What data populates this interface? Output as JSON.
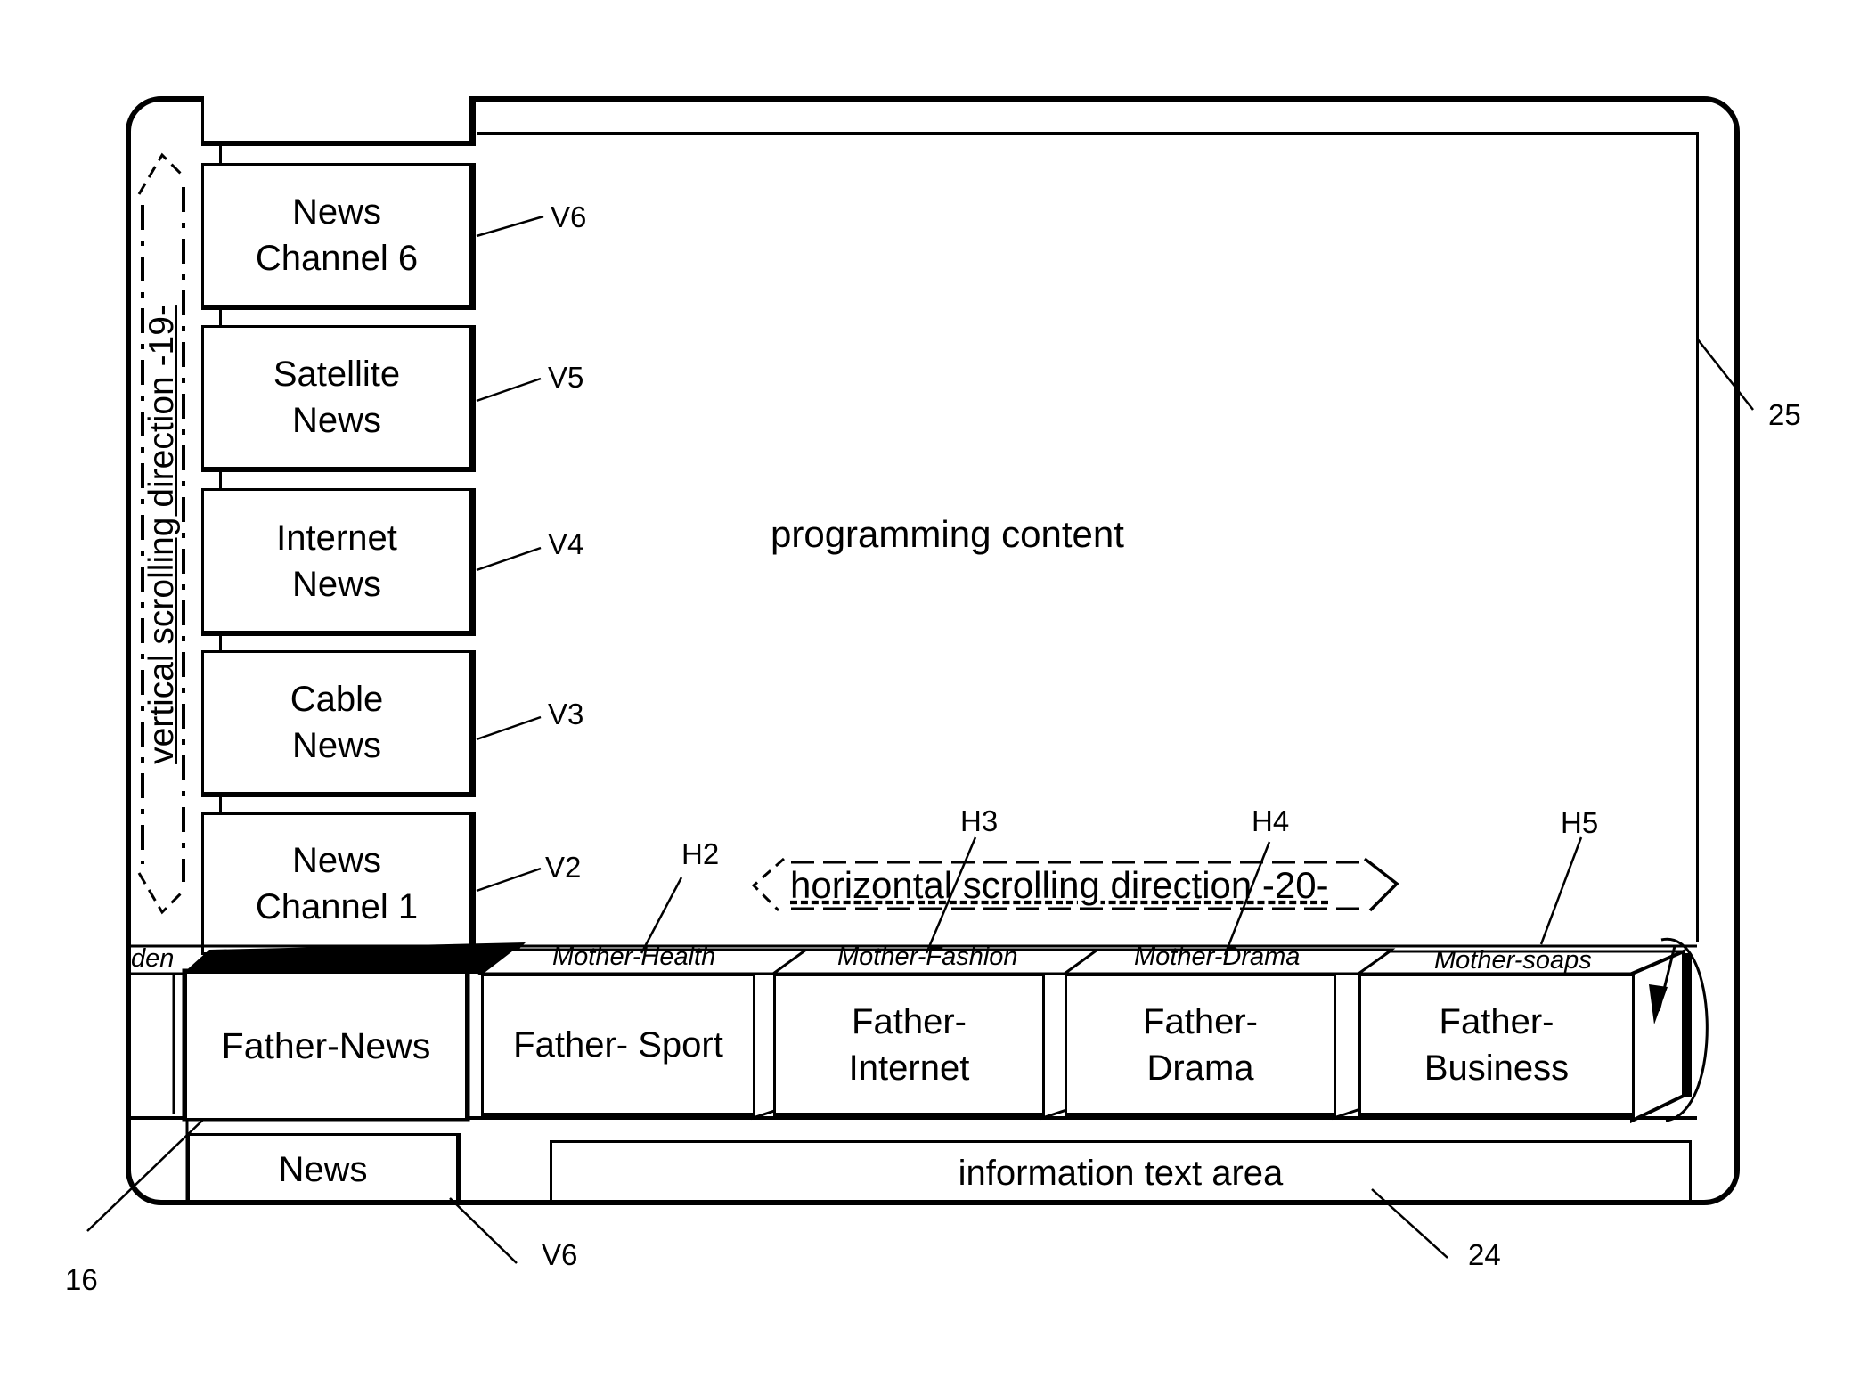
{
  "figure": {
    "programming_content": "programming content",
    "information_area": "information text area",
    "category_box": "News",
    "partial_left_label": "den"
  },
  "vertical_menu": {
    "direction_label": "vertical scrolling direction -19-",
    "items": [
      {
        "label_line1": "News",
        "label_line2": "Channel 6",
        "ref": "V6"
      },
      {
        "label_line1": "Satellite",
        "label_line2": "News",
        "ref": "V5"
      },
      {
        "label_line1": "Internet",
        "label_line2": "News",
        "ref": "V4"
      },
      {
        "label_line1": "Cable",
        "label_line2": "News",
        "ref": "V3"
      },
      {
        "label_line1": "News",
        "label_line2": "Channel 1",
        "ref": "V2"
      }
    ]
  },
  "horizontal_menu": {
    "direction_label": "horizontal scrolling direction -20-",
    "items": [
      {
        "label": "Father-News",
        "top_label": "",
        "ref": "",
        "selected": true
      },
      {
        "label": "Father- Sport",
        "top_label": "Mother-Health",
        "ref": "H2"
      },
      {
        "label_line1": "Father-",
        "label_line2": "Internet",
        "top_label": "Mother-Fashion",
        "ref": "H3"
      },
      {
        "label_line1": "Father-",
        "label_line2": "Drama",
        "top_label": "Mother-Drama",
        "ref": "H4"
      },
      {
        "label_line1": "Father-",
        "label_line2": "Business",
        "top_label": "Mother-soaps",
        "ref": "H5"
      }
    ]
  },
  "reference_numerals": {
    "content_area": "25",
    "info_area": "24",
    "selected_item": "16",
    "category_box": "V6"
  }
}
